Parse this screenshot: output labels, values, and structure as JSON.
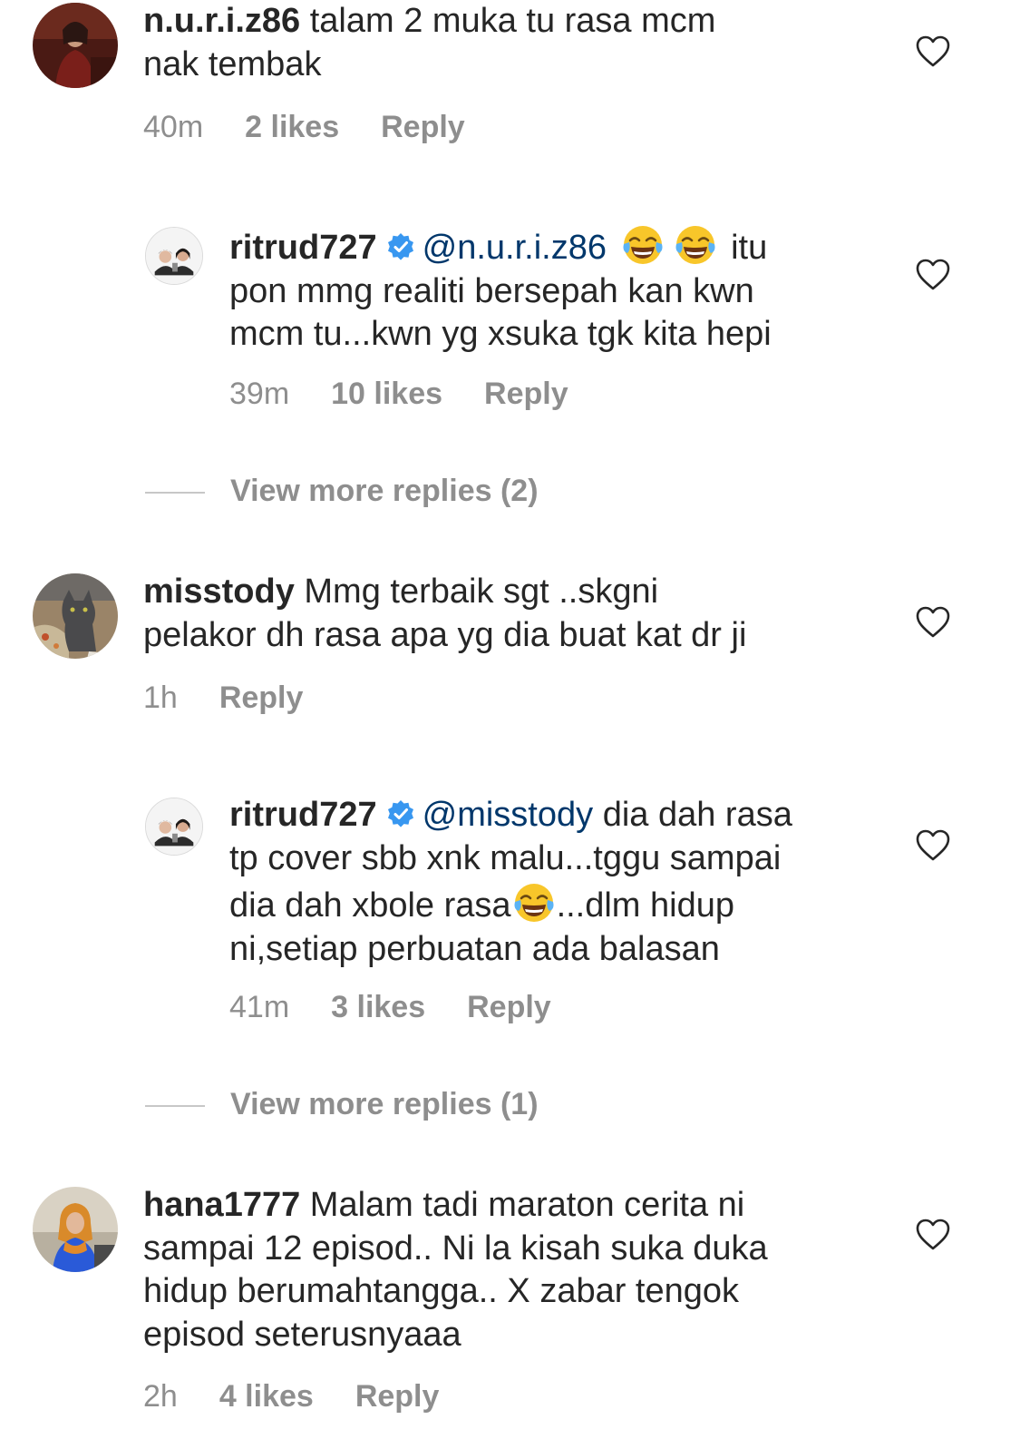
{
  "comments": [
    {
      "username": "n.u.r.i.z86",
      "lines": [
        "talam 2 muka tu rasa mcm",
        "nak tembak"
      ],
      "time": "40m",
      "likes": "2 likes",
      "reply": "Reply"
    },
    {
      "username": "ritrud727",
      "mention": "@n.u.r.i.z86",
      "first_tail": "itu",
      "lines": [
        "pon mmg realiti bersepah kan kwn",
        "mcm tu...kwn yg xsuka tgk kita hepi"
      ],
      "time": "39m",
      "likes": "10 likes",
      "reply": "Reply"
    },
    {
      "view_more": "View more replies (2)"
    },
    {
      "username": "misstody",
      "lines": [
        "Mmg terbaik sgt ..skgni",
        "pelakor dh rasa apa yg dia buat kat dr ji"
      ],
      "time": "1h",
      "reply": "Reply"
    },
    {
      "username": "ritrud727",
      "mention": "@misstody",
      "first_tail": "dia dah rasa",
      "lines": [
        "tp cover sbb xnk malu...tggu sampai",
        "dia dah xbole rasa",
        "...dlm hidup",
        "ni,setiap perbuatan ada balasan"
      ],
      "time": "41m",
      "likes": "3 likes",
      "reply": "Reply"
    },
    {
      "view_more": "View more replies (1)"
    },
    {
      "username": "hana1777",
      "lines": [
        "Malam tadi maraton cerita ni",
        "sampai 12 episod.. Ni la kisah suka duka",
        "hidup berumahtangga.. X zabar tengok",
        "episod seterusnyaaa"
      ],
      "time": "2h",
      "likes": "4 likes",
      "reply": "Reply"
    }
  ],
  "colors": {
    "text": "#262626",
    "meta": "#8e8e8e",
    "mention": "#00376b",
    "verified": "#3897f0"
  }
}
